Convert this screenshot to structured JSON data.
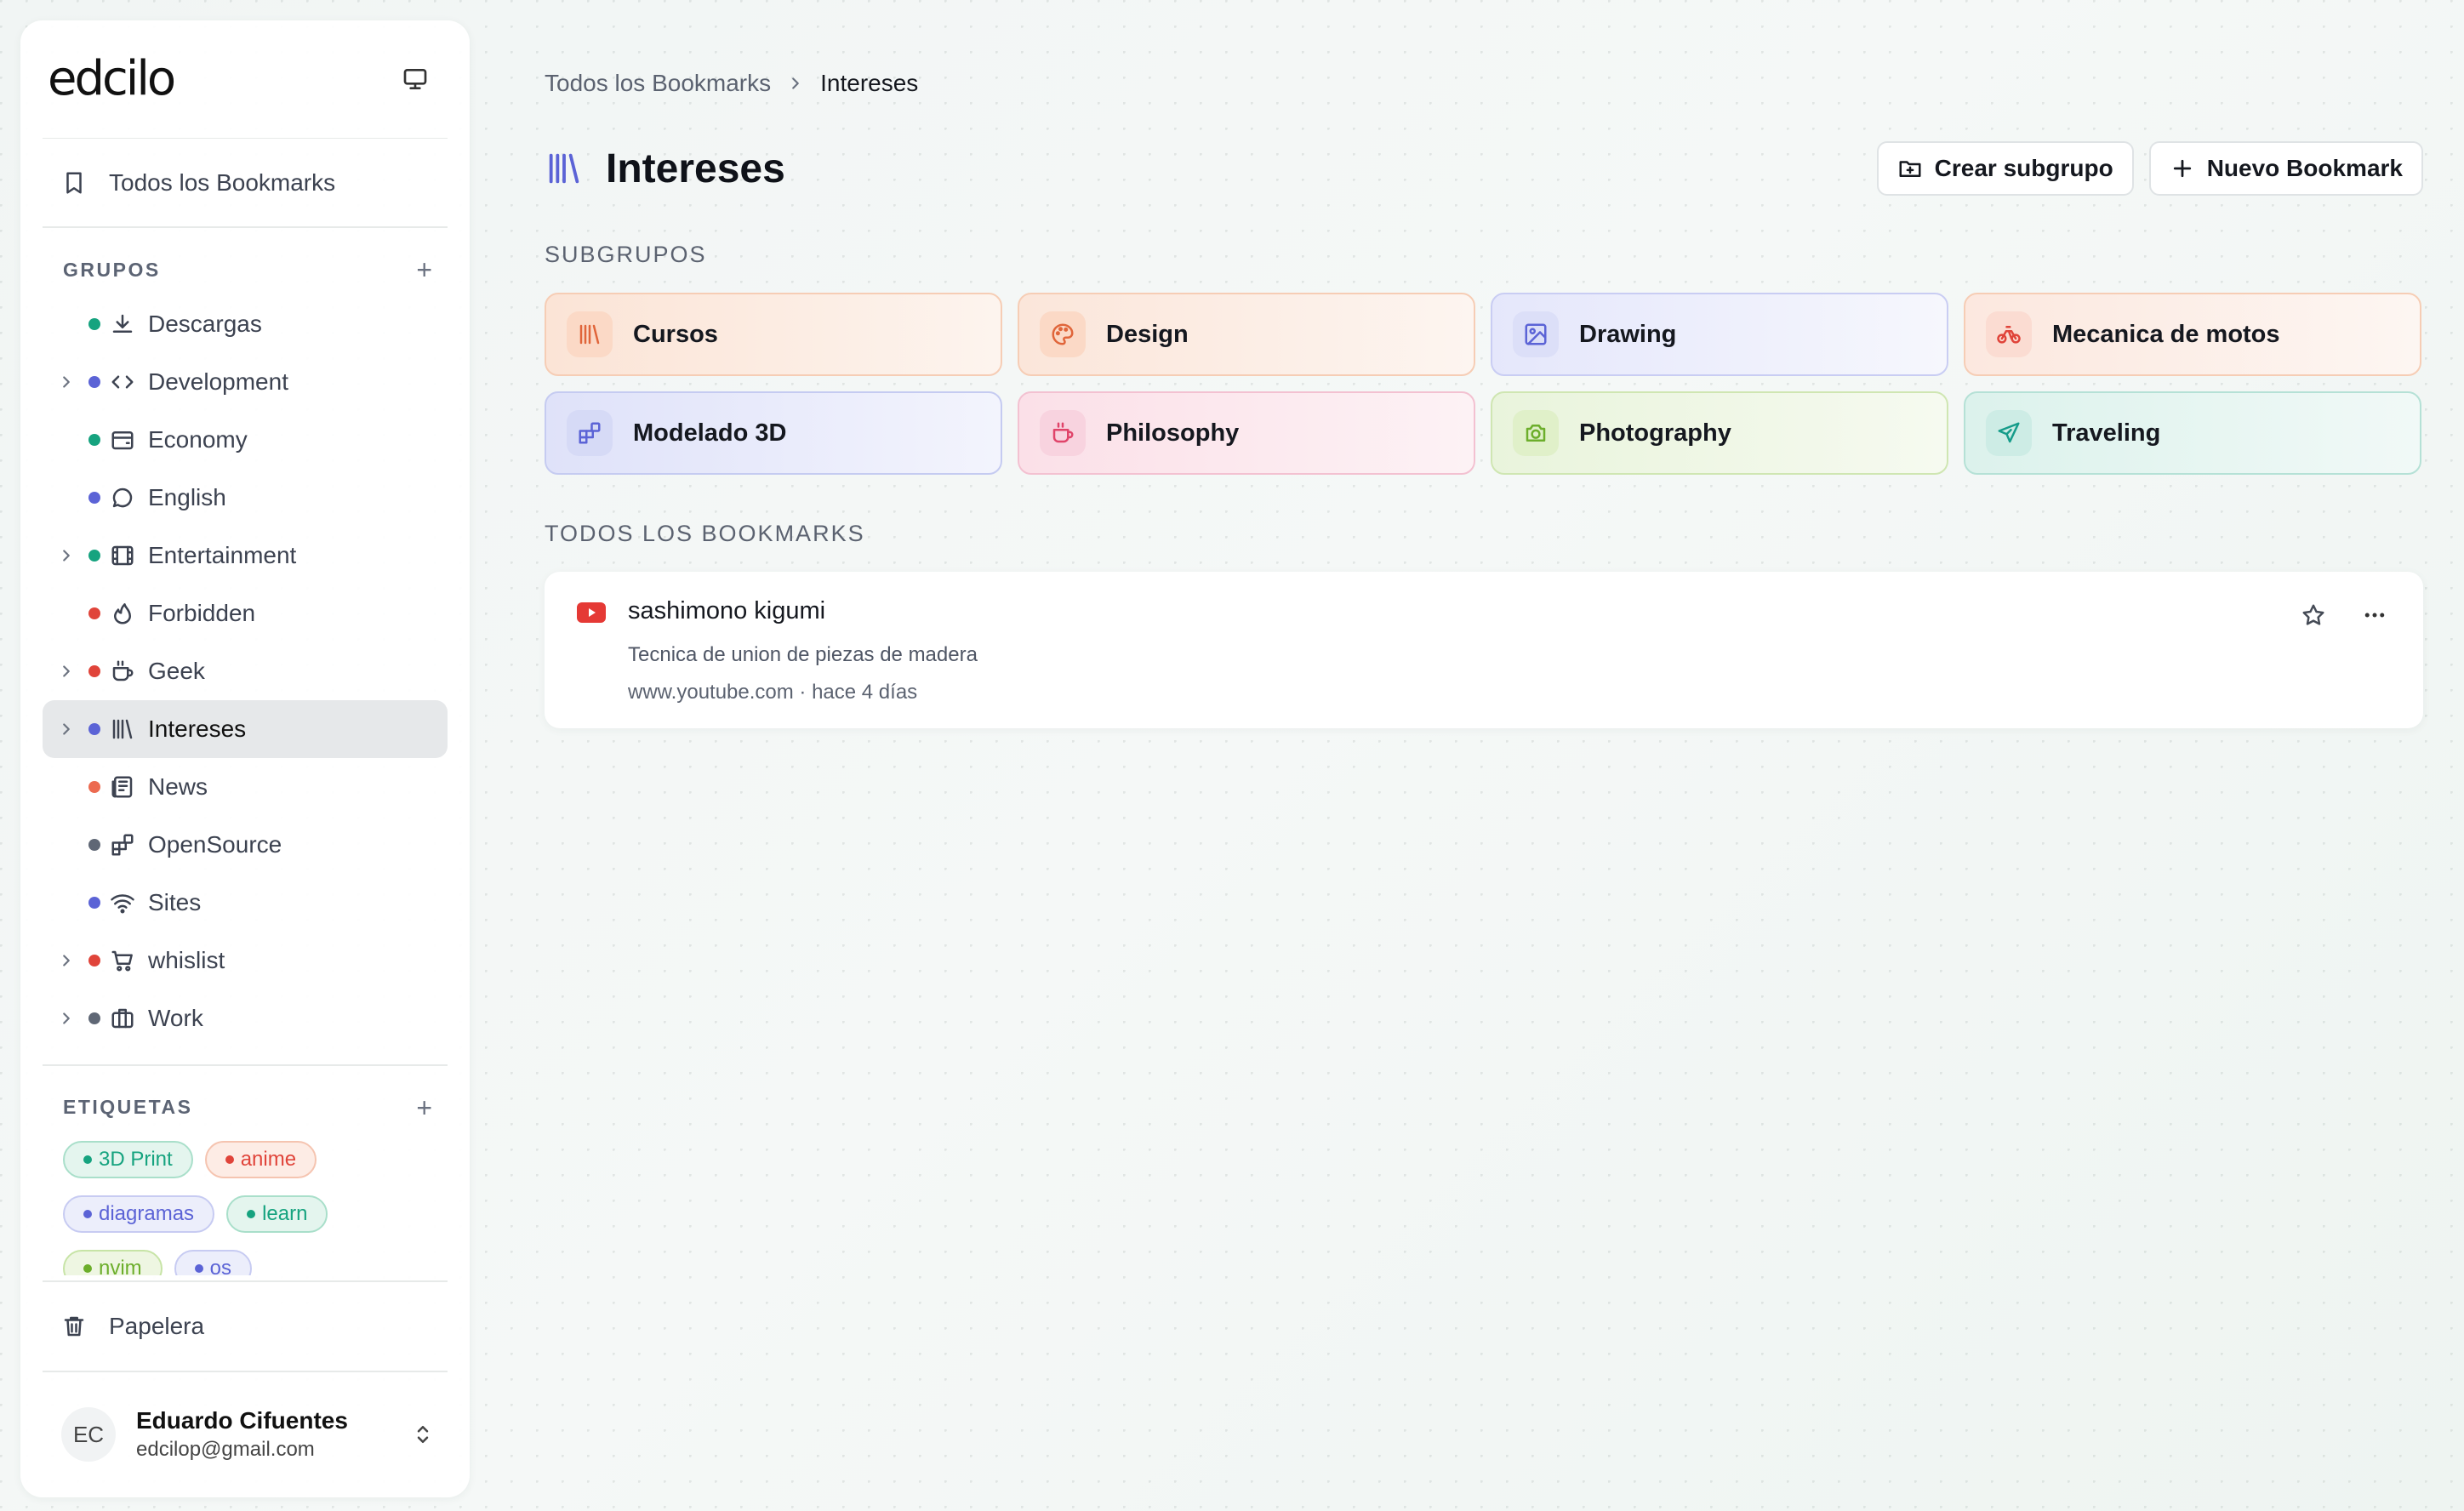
{
  "sidebar": {
    "logo": "edcilo",
    "all_bookmarks": "Todos los Bookmarks",
    "groups_title": "GRUPOS",
    "groups": [
      {
        "label": "Descargas",
        "dot": "#16a37f",
        "icon": "download-icon",
        "expandable": false,
        "active": false
      },
      {
        "label": "Development",
        "dot": "#5b63d6",
        "icon": "code-icon",
        "expandable": true,
        "active": false
      },
      {
        "label": "Economy",
        "dot": "#16a37f",
        "icon": "wallet-icon",
        "expandable": false,
        "active": false
      },
      {
        "label": "English",
        "dot": "#5b63d6",
        "icon": "chat-bubble-icon",
        "expandable": false,
        "active": false
      },
      {
        "label": "Entertainment",
        "dot": "#16a37f",
        "icon": "film-icon",
        "expandable": true,
        "active": false
      },
      {
        "label": "Forbidden",
        "dot": "#e0443a",
        "icon": "flame-icon",
        "expandable": false,
        "active": false
      },
      {
        "label": "Geek",
        "dot": "#e0443a",
        "icon": "coffee-icon",
        "expandable": true,
        "active": false
      },
      {
        "label": "Intereses",
        "dot": "#5b63d6",
        "icon": "library-icon",
        "expandable": true,
        "active": true
      },
      {
        "label": "News",
        "dot": "#ec6a50",
        "icon": "newspaper-icon",
        "expandable": false,
        "active": false
      },
      {
        "label": "OpenSource",
        "dot": "#5f6775",
        "icon": "blocks-icon",
        "expandable": false,
        "active": false
      },
      {
        "label": "Sites",
        "dot": "#5b63d6",
        "icon": "wifi-icon",
        "expandable": false,
        "active": false
      },
      {
        "label": "whislist",
        "dot": "#e0443a",
        "icon": "cart-icon",
        "expandable": true,
        "active": false
      },
      {
        "label": "Work",
        "dot": "#5f6775",
        "icon": "briefcase-icon",
        "expandable": true,
        "active": false
      }
    ],
    "tags_title": "ETIQUETAS",
    "tags": [
      {
        "label": "3D Print",
        "color": "#16a37f",
        "bg": "#e4f5ee",
        "border": "#a9dfca"
      },
      {
        "label": "anime",
        "color": "#e0443a",
        "bg": "#fdece5",
        "border": "#f5c4b0"
      },
      {
        "label": "diagramas",
        "color": "#5b63d6",
        "bg": "#eceefb",
        "border": "#c7cbf2"
      },
      {
        "label": "learn",
        "color": "#16a37f",
        "bg": "#e4f5ee",
        "border": "#a9dfca"
      },
      {
        "label": "nvim",
        "color": "#6cae2b",
        "bg": "#eef6e2",
        "border": "#c7e4a6"
      },
      {
        "label": "os",
        "color": "#5b63d6",
        "bg": "#eceefb",
        "border": "#c7cbf2"
      }
    ],
    "trash": "Papelera",
    "user": {
      "initials": "EC",
      "name": "Eduardo Cifuentes",
      "email": "edcilop@gmail.com"
    }
  },
  "main": {
    "breadcrumb": {
      "root": "Todos los Bookmarks",
      "current": "Intereses"
    },
    "title": "Intereses",
    "buttons": {
      "create_subgroup": "Crear subgrupo",
      "new_bookmark": "Nuevo Bookmark"
    },
    "subgroups_title": "SUBGRUPOS",
    "subgroups": [
      {
        "label": "Cursos",
        "icon": "library-icon",
        "accent": "#e0653a",
        "iconbg": "#fbd9c6",
        "from": "#fbe4d6",
        "to": "#fdf4ee",
        "border": "#f6cdb5"
      },
      {
        "label": "Design",
        "icon": "palette-icon",
        "accent": "#e0653a",
        "iconbg": "#fbd9c6",
        "from": "#fbe6da",
        "to": "#fdf5f0",
        "border": "#f6cdb5"
      },
      {
        "label": "Drawing",
        "icon": "image-icon",
        "accent": "#5b63d6",
        "iconbg": "#dcdff8",
        "from": "#e5e7fb",
        "to": "#f6f7fd",
        "border": "#c9cdf3"
      },
      {
        "label": "Mecanica de motos",
        "icon": "bike-icon",
        "accent": "#e0443a",
        "iconbg": "#fbdcd2",
        "from": "#fce8df",
        "to": "#fdf6f2",
        "border": "#f6cdb5"
      },
      {
        "label": "Modelado 3D",
        "icon": "blocks-icon",
        "accent": "#5b63d6",
        "iconbg": "#d6daf6",
        "from": "#dfe2f9",
        "to": "#f3f4fd",
        "border": "#c5cbf1"
      },
      {
        "label": "Philosophy",
        "icon": "coffee-icon",
        "accent": "#e0446a",
        "iconbg": "#f8d3df",
        "from": "#fbe0e8",
        "to": "#fdf2f5",
        "border": "#f3c1d1"
      },
      {
        "label": "Photography",
        "icon": "camera-icon",
        "accent": "#6cae2b",
        "iconbg": "#e0f0c9",
        "from": "#e9f4dc",
        "to": "#f6faf0",
        "border": "#cfe6b2"
      },
      {
        "label": "Traveling",
        "icon": "plane-icon",
        "accent": "#169c8a",
        "iconbg": "#cdece5",
        "from": "#dcf2ec",
        "to": "#f1f9f7",
        "border": "#b5e1d6"
      }
    ],
    "bookmarks_title": "TODOS LOS BOOKMARKS",
    "bookmarks": [
      {
        "title": "sashimono kigumi",
        "description": "Tecnica de union de piezas de madera",
        "meta": "www.youtube.com · hace 4 días",
        "favicon": "youtube-icon"
      }
    ]
  }
}
